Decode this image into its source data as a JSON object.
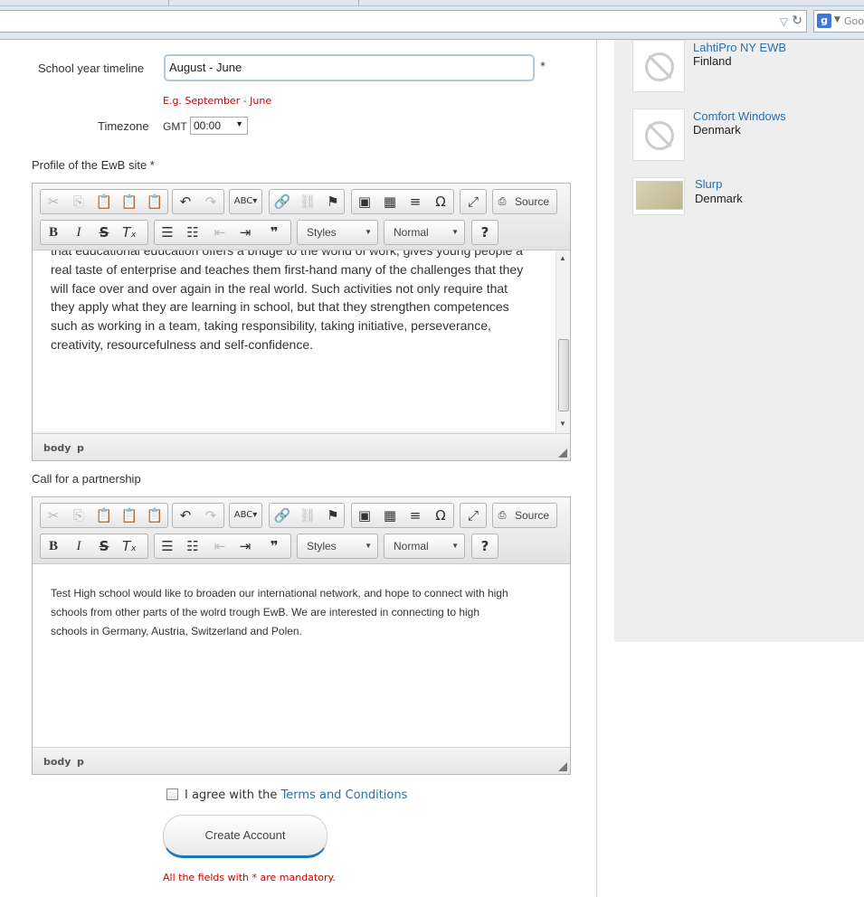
{
  "browser": {
    "search_text": "Goog"
  },
  "form": {
    "school_year_label": "School year timeline",
    "school_year_value": "August - June",
    "school_year_hint": "E.g. September - June",
    "required_mark": "*",
    "timezone_label": "Timezone",
    "timezone_prefix": "GMT",
    "timezone_value": "00:00",
    "profile_label": "Profile of the EwB site *",
    "call_label": "Call for a partnership",
    "agree_text": "I agree with the",
    "terms_link": "Terms and Conditions",
    "create_button": "Create Account",
    "mandatory_note": "All the fields with * are mandatory."
  },
  "editor": {
    "source_label": "Source",
    "styles_label": "Styles",
    "format_label": "Normal",
    "help_label": "?",
    "path_body": "body",
    "path_p": "p"
  },
  "profile_text": [
    "that educational education offers a bridge to the world of work, gives young people a",
    "real taste of enterprise and teaches them first-hand many of the challenges that they",
    "will face over and over again in the real world. Such activities not only require that",
    "they apply what they are learning in school, but that they strengthen competences",
    "such as working in a team, taking responsibility, taking initiative, perseverance,",
    "creativity, resourcefulness and self-confidence."
  ],
  "call_text": [
    "Test High school would like to broaden our international network, and hope to connect with high",
    "schools from other parts of the wolrd trough EwB. We are interested in connecting to high",
    "schools in Germany, Austria, Switzerland and Polen."
  ],
  "sidebar": {
    "items": [
      {
        "name": "LahtiPro NY EWB",
        "country": "Finland"
      },
      {
        "name": "Comfort Windows",
        "country": "Denmark"
      },
      {
        "name": "Slurp",
        "country": "Denmark"
      }
    ]
  }
}
